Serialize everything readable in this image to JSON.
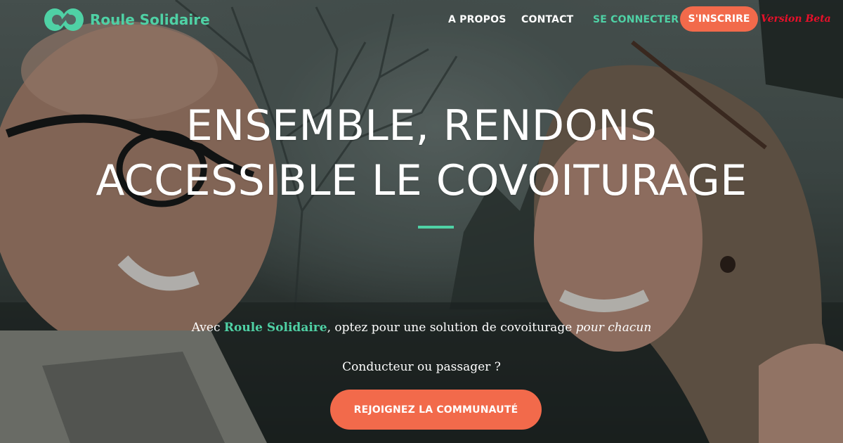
{
  "brand": {
    "name": "Roule Solidaire",
    "logo_icon": "infinity-loop-logo",
    "accent_color": "#4fd1a5"
  },
  "nav": {
    "about": "A PROPOS",
    "contact": "CONTACT",
    "login": "SE CONNECTER",
    "signup": "S'INSCRIRE",
    "beta": "Version Beta"
  },
  "hero": {
    "headline_line1": "ENSEMBLE, RENDONS",
    "headline_line2": "ACCESSIBLE LE COVOITURAGE",
    "tagline_prefix": "Avec ",
    "tagline_brand": "Roule Solidaire",
    "tagline_middle": ", optez pour une solution de covoiturage ",
    "tagline_emphasis": "pour chacun",
    "question": "Conducteur ou passager ?",
    "cta": "REJOIGNEZ LA COMMUNAUTÉ",
    "cta_color": "#f26a4b"
  }
}
